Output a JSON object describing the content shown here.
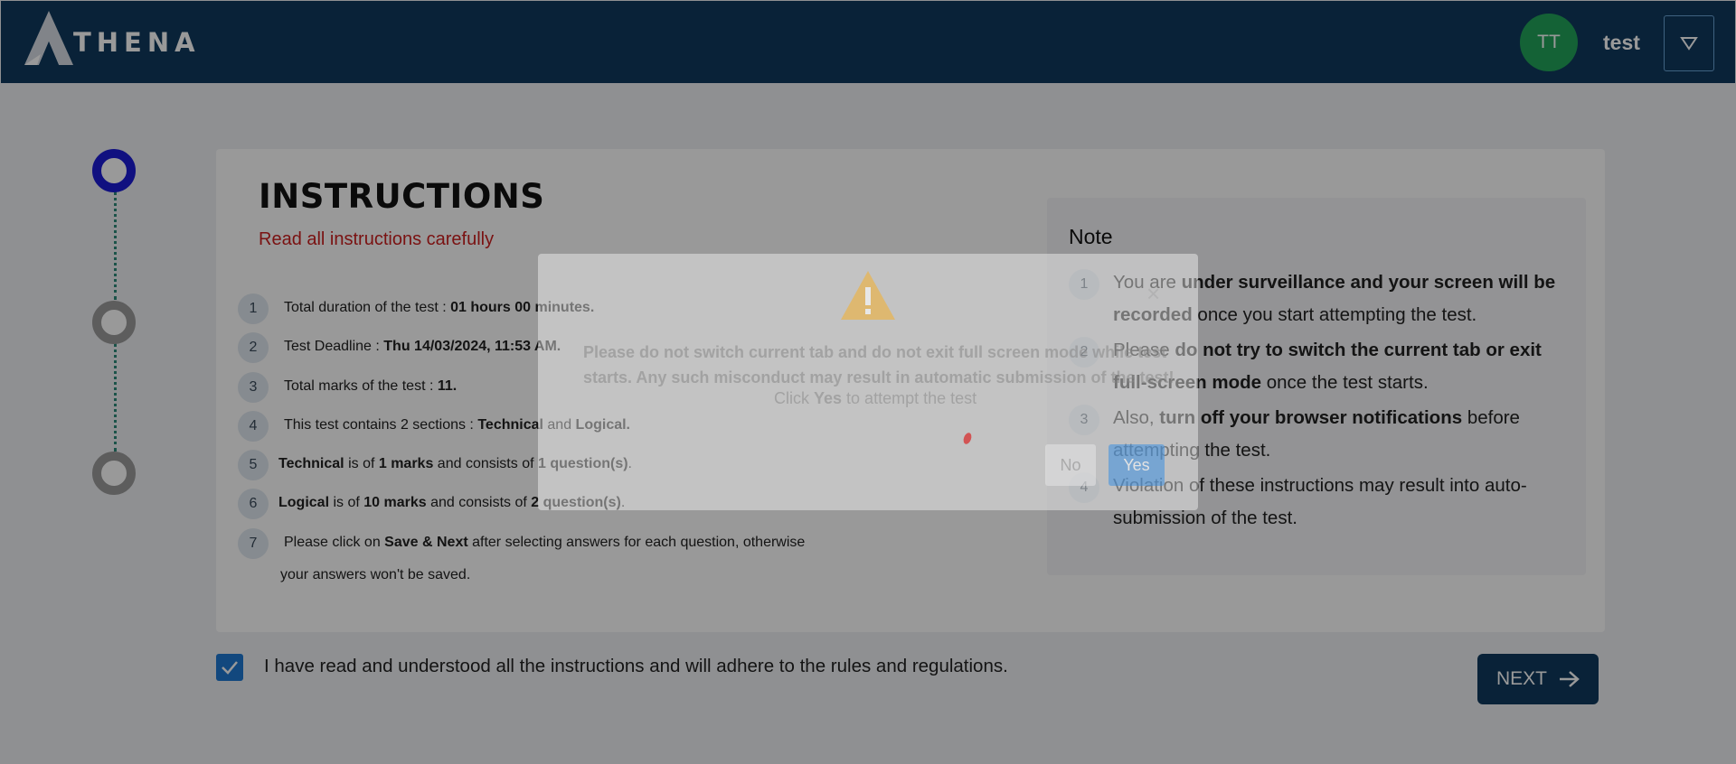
{
  "header": {
    "logo_text": "THENA",
    "avatar_initials": "TT",
    "username": "test"
  },
  "instructions": {
    "title": "INSTRUCTIONS",
    "subtitle": "Read all instructions carefully",
    "items": [
      {
        "num": "1",
        "pre": "Total duration of the test : ",
        "bold": "01 hours 00 minutes.",
        "post": ""
      },
      {
        "num": "2",
        "pre": "Test Deadline : ",
        "bold": "Thu 14/03/2024, 11:53 AM.",
        "post": ""
      },
      {
        "num": "3",
        "pre": "Total marks of the test : ",
        "bold": "11.",
        "post": ""
      },
      {
        "num": "4",
        "pre": "This test contains 2 sections : ",
        "bold": "Technical",
        "mid": " and ",
        "bold2": "Logical."
      },
      {
        "num": "5",
        "bold": "Technical",
        "t1": " is of ",
        "b2": "1 marks",
        "t2": " and consists of ",
        "b3": "1 question(s)",
        "t3": "."
      },
      {
        "num": "6",
        "bold": "Logical",
        "t1": " is of ",
        "b2": "10 marks",
        "t2": " and consists of ",
        "b3": "2 question(s)",
        "t3": "."
      },
      {
        "num": "7",
        "pre": "Please click on ",
        "bold": "Save & Next",
        "post": " after selecting answers for each question, otherwise",
        "line2": "your answers won't be saved."
      }
    ]
  },
  "note": {
    "title": "Note",
    "items": [
      {
        "num": "1",
        "pre": "You are ",
        "bold": "under surveillance and your screen will be recorded",
        "post": " once you start attempting the test."
      },
      {
        "num": "2",
        "pre": "Please ",
        "bold": "do not try to switch the current tab or exit full-screen mode",
        "post": " once the test starts."
      },
      {
        "num": "3",
        "pre": "Also, ",
        "bold": "turn off your browser notifications",
        "post": " before attempting the test."
      },
      {
        "num": "4",
        "pre": "Violation of these instructions may result into auto-submission of the test.",
        "bold": "",
        "post": ""
      }
    ]
  },
  "agreement": {
    "checked": true,
    "label": "I have read and understood all the instructions and will adhere to the rules and regulations."
  },
  "next_button": {
    "label": "NEXT"
  },
  "modal": {
    "message": "Please do not switch current tab and do not exit full screen mode while test starts. Any such misconduct may result in automatic submission of the test!",
    "click_pre": "Click ",
    "click_bold": "Yes",
    "click_post": " to attempt the test",
    "no_label": "No",
    "yes_label": "Yes",
    "close": "×"
  },
  "colors": {
    "header_bg": "#0f3a5e",
    "avatar_bg": "#22a35a",
    "subtitle_red": "#cc1f1f",
    "step_active": "#1c1cd6",
    "checkbox": "#1e78d2"
  },
  "stepper": {
    "steps": 3,
    "active": 1
  }
}
